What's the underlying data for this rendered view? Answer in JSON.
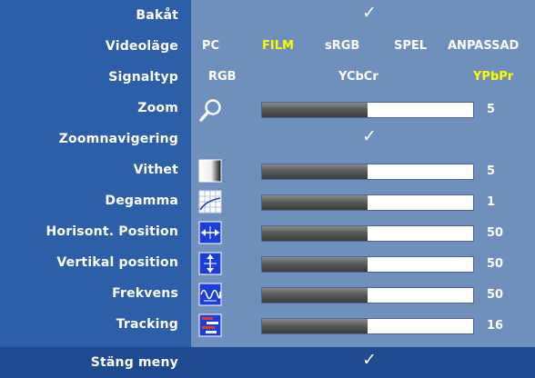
{
  "menu": {
    "rows": [
      {
        "label": "Bakåt",
        "check": "✓"
      },
      {
        "label": "Videoläge",
        "options": [
          "PC",
          "FILM",
          "sRGB",
          "SPEL",
          "ANPASSAD"
        ],
        "selected": "FILM"
      },
      {
        "label": "Signaltyp",
        "options": [
          "RGB",
          "YCbCr",
          "YPbPr"
        ],
        "selected": "YPbPr"
      },
      {
        "label": "Zoom",
        "icon": "magnifier-icon",
        "level": 0.5,
        "value": "5"
      },
      {
        "label": "Zoomnavigering",
        "check": "✓"
      },
      {
        "label": "Vithet",
        "icon": "whiteness-gradient-icon",
        "level": 0.5,
        "value": "5"
      },
      {
        "label": "Degamma",
        "icon": "degamma-curve-icon",
        "level": 0.5,
        "value": "1"
      },
      {
        "label": "Horisont. Position",
        "icon": "horizontal-position-icon",
        "level": 0.5,
        "value": "50"
      },
      {
        "label": "Vertikal position",
        "icon": "vertical-position-icon",
        "level": 0.5,
        "value": "50"
      },
      {
        "label": "Frekvens",
        "icon": "frequency-wave-icon",
        "level": 0.5,
        "value": "50"
      },
      {
        "label": "Tracking",
        "icon": "tracking-bars-icon",
        "level": 0.5,
        "value": "16"
      }
    ],
    "close": {
      "label": "Stäng meny",
      "check": "✓"
    }
  },
  "colors": {
    "label_bg": "#2c5fa8",
    "panel_bg": "#6f8fbd",
    "selected_text": "#ffff00",
    "close_bg": "#1e4b8f"
  }
}
